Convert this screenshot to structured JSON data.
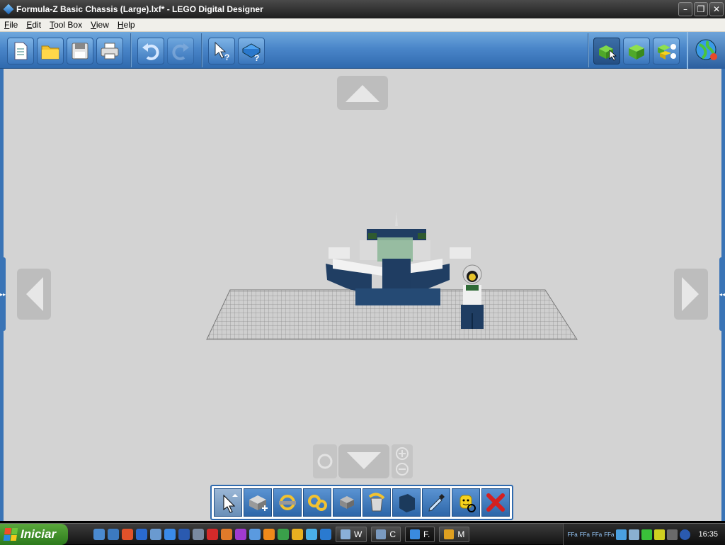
{
  "window": {
    "title": "Formula-Z Basic Chassis (Large).lxf* - LEGO Digital Designer",
    "buttons": [
      "minimize",
      "restore",
      "close"
    ]
  },
  "menu": [
    {
      "label": "File"
    },
    {
      "label": "Edit"
    },
    {
      "label": "Tool Box"
    },
    {
      "label": "View"
    },
    {
      "label": "Help"
    }
  ],
  "toolbar": {
    "file_tools": [
      "new-file-icon",
      "open-folder-icon",
      "save-disk-icon",
      "print-icon"
    ],
    "history_tools": [
      "undo-icon",
      "redo-icon"
    ],
    "help_tools": [
      "pointer-help-icon",
      "book-help-icon"
    ],
    "mode_tools": [
      "build-mode-icon",
      "view-mode-icon",
      "building-guide-mode-icon"
    ],
    "online_icon": "globe-icon"
  },
  "canvas": {
    "background": "#d3d3d3",
    "scene": "LEGO Formula-Z chassis with minifigure on baseplate"
  },
  "palette": {
    "tools": [
      {
        "name": "select-tool",
        "icon": "cursor-icon",
        "active": true
      },
      {
        "name": "clone-tool",
        "icon": "clone-brick-icon"
      },
      {
        "name": "hinge-tool",
        "icon": "hinge-icon"
      },
      {
        "name": "hinge-align-tool",
        "icon": "hinge-align-icon"
      },
      {
        "name": "flex-tool",
        "icon": "flex-brick-icon"
      },
      {
        "name": "paint-tool",
        "icon": "paint-bucket-icon"
      },
      {
        "name": "color-swatch",
        "icon": "color-swatch-icon",
        "color": "#1b3a5c"
      },
      {
        "name": "color-picker-tool",
        "icon": "eyedropper-icon"
      },
      {
        "name": "hide-tool",
        "icon": "minifig-head-icon"
      },
      {
        "name": "delete-tool",
        "icon": "red-x-icon"
      }
    ]
  },
  "taskbar": {
    "start_label": "Iniciar",
    "tasks": [
      {
        "label": "W"
      },
      {
        "label": "C"
      },
      {
        "label": "F.",
        "active": true
      },
      {
        "label": "M"
      }
    ],
    "tray_labels": [
      "FFa",
      "FFa",
      "FFa",
      "FFa"
    ],
    "clock": "16:35"
  },
  "colors": {
    "accent": "#3a74b6",
    "toolbar": "#4a86c9",
    "canvas": "#d3d3d3",
    "start": "#3c9228"
  }
}
